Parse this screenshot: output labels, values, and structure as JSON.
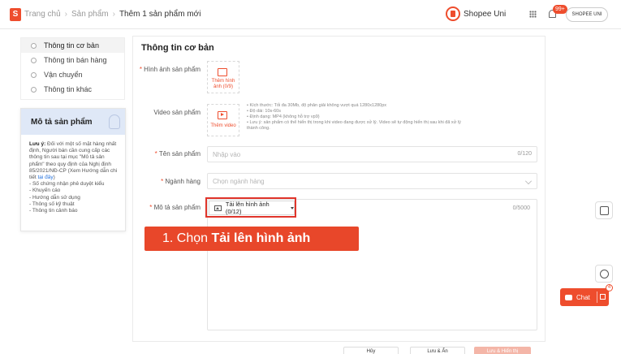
{
  "brand": {
    "accent": "#ee4d2d",
    "logo_letter": "S"
  },
  "breadcrumb": [
    "Trang chủ",
    "Sản phẩm",
    "Thêm 1 sản phẩm mới"
  ],
  "header": {
    "uni_label": "Shopee Uni",
    "notif_badge": "99+",
    "shop_label": "SHOPEE UNI"
  },
  "nav": [
    {
      "label": "Thông tin cơ bản"
    },
    {
      "label": "Thông tin bán hàng"
    },
    {
      "label": "Vận chuyển"
    },
    {
      "label": "Thông tin khác"
    }
  ],
  "desc_card": {
    "title": "Mô tả sản phẩm",
    "note_prefix": "Lưu ý:",
    "note_body": " Đối với một số mặt hàng nhất định, Người bán cần cung cấp các thông tin sau tại mục \"Mô tả sản phẩm\" theo quy định của Nghị định 85/2021/NĐ-CP (Xem Hướng dẫn chi tiết ",
    "note_link": "tại đây",
    "note_close": ")",
    "items": [
      "- Số chứng nhận phê duyệt kiểu",
      "- Khuyến cáo",
      "- Hướng dẫn sử dụng",
      "- Thông số kỹ thuật",
      "- Thông tin cảnh báo"
    ]
  },
  "form": {
    "section_title": "Thông tin cơ bản",
    "image": {
      "label": "Hình ảnh sản phẩm",
      "upload_text": "Thêm hình ảnh (0/9)"
    },
    "video": {
      "label": "Video sản phẩm",
      "upload_text": "Thêm video",
      "notes": [
        "Kích thước: Tối đa 30Mb, độ phân giải không vượt quá 1280x1280px",
        "Độ dài: 10s-60s",
        "Định dạng: MP4 (không hỗ trợ vp9)",
        "Lưu ý: sản phẩm có thể hiển thị trong khi video đang được xử lý. Video sẽ tự động hiển thị sau khi đã xử lý thành công."
      ]
    },
    "name": {
      "label": "Tên sản phẩm",
      "placeholder": "Nhập vào",
      "count": "0/120"
    },
    "category": {
      "label": "Ngành hàng",
      "placeholder": "Chọn ngành hàng"
    },
    "description": {
      "label": "Mô tả sản phẩm",
      "count": "0/5000",
      "upload_button": "Tải lên hình ảnh (0/12)"
    }
  },
  "callout": {
    "prefix": "1. Chọn ",
    "bold": "Tải lên hình ảnh"
  },
  "footer": {
    "btn1": "Hủy",
    "btn2": "Lưu & Ẩn",
    "btn3": "Lưu & Hiển thị"
  },
  "chat": {
    "label": "Chat",
    "badge": "4"
  }
}
